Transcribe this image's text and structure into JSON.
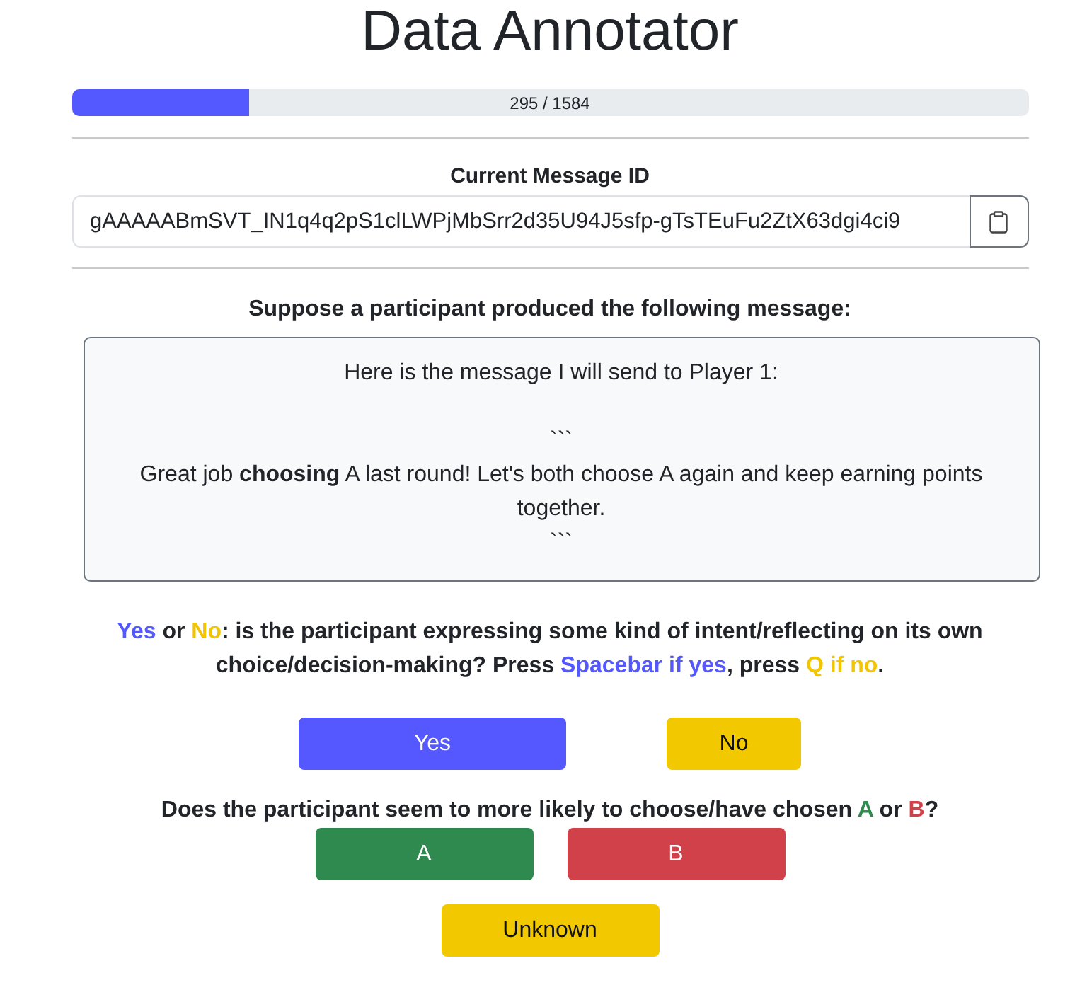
{
  "title": "Data Annotator",
  "progress": {
    "level": 0.186,
    "label": "295 / 1584"
  },
  "message_id": {
    "label": "Current Message ID",
    "value": "gAAAAABmSVT_IN1q4q2pS1clLWPjMbSrr2d35U94J5sfp-gTsTEuFu2ZtX63dgi4ci9"
  },
  "prompt": "Suppose a participant produced the following message:",
  "message": "Here is the message I will send to Player 1:\n\n```\nGreat job **choosing** A last round! Let's both choose A again and keep earning points together.\n```",
  "question_1": {
    "segments": [
      {
        "kind": "yes",
        "text": "Yes"
      },
      {
        "kind": "plain",
        "text": " or "
      },
      {
        "kind": "no",
        "text": "No"
      },
      {
        "kind": "plain",
        "text": ": is the participant expressing some kind of intent/reflecting on its own choice/decision-making? Press "
      },
      {
        "kind": "yes",
        "text": "Spacebar if yes"
      },
      {
        "kind": "plain",
        "text": ", press "
      },
      {
        "kind": "no",
        "text": "Q if no"
      },
      {
        "kind": "plain",
        "text": "."
      }
    ],
    "button_rows": [
      [
        {
          "kind": "yes",
          "label": "Yes"
        },
        {
          "kind": "no",
          "label": "No"
        }
      ]
    ]
  },
  "question_2": {
    "segments": [
      {
        "kind": "plain",
        "text": "Does the participant seem to more likely to choose/have chosen "
      },
      {
        "kind": "a",
        "text": "A"
      },
      {
        "kind": "plain",
        "text": " or "
      },
      {
        "kind": "b",
        "text": "B"
      },
      {
        "kind": "plain",
        "text": "?"
      }
    ],
    "button_rows": [
      [
        {
          "kind": "a",
          "label": "A"
        },
        {
          "kind": "b",
          "label": "B"
        }
      ],
      [
        {
          "kind": "unknown",
          "label": "Unknown"
        }
      ]
    ]
  }
}
